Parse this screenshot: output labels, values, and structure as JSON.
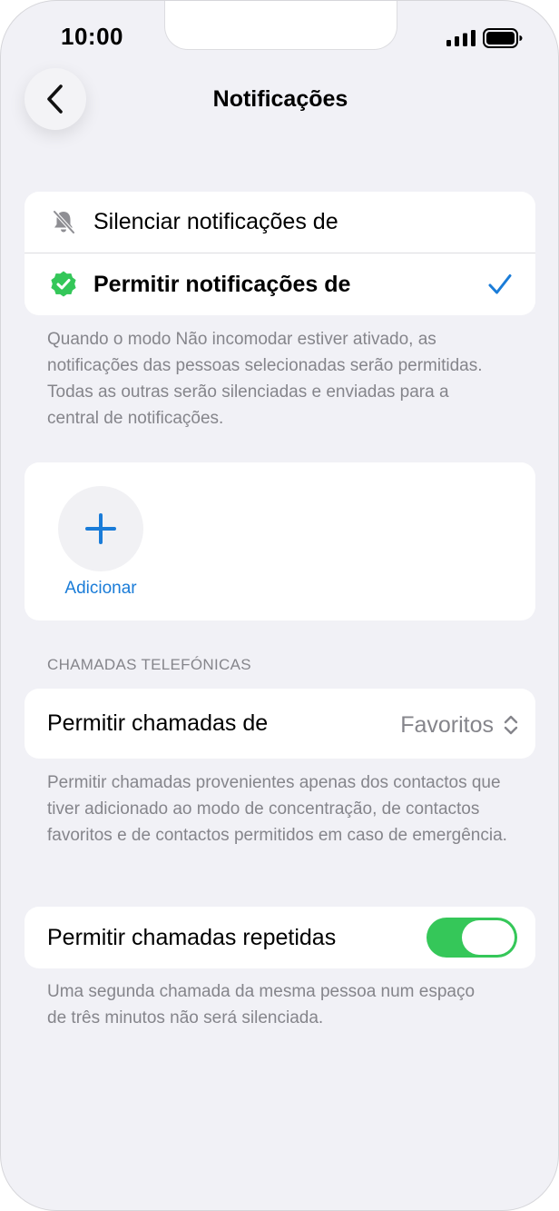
{
  "status_bar": {
    "time": "10:00"
  },
  "nav": {
    "title": "Notificações"
  },
  "notify_options": {
    "silence_label": "Silenciar notificações de",
    "allow_label": "Permitir notificações de",
    "footer": "Quando o modo Não incomodar estiver ativado, as notificações das pessoas selecionadas serão permitidas. Todas as outras serão silenciadas e enviadas para a central de notificações."
  },
  "people": {
    "add_label": "Adicionar"
  },
  "calls": {
    "section_header": "CHAMADAS TELEFÓNICAS",
    "allow_calls_label": "Permitir chamadas de",
    "allow_calls_value": "Favoritos",
    "allow_calls_footer": "Permitir chamadas provenientes apenas dos contactos que tiver adicionado ao modo de concentração, de contactos favoritos e de contactos permitidos em caso de emergência.",
    "repeated_label": "Permitir chamadas repetidas",
    "repeated_on": true,
    "repeated_footer": "Uma segunda chamada da mesma pessoa num espaço de três minutos não será silenciada."
  },
  "colors": {
    "accent": "#1a7cd8",
    "toggle_on": "#35c759",
    "verified": "#34c759"
  }
}
